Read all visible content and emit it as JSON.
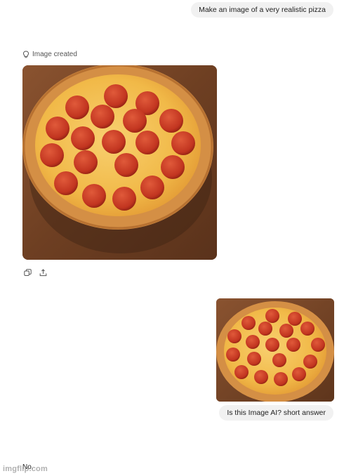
{
  "conversation": {
    "user_prompt_1": "Make an image of a very realistic pizza",
    "status_label": "Image created",
    "user_prompt_2": "Is this Image AI? short answer",
    "assistant_answer": "No."
  },
  "image_alt": {
    "generated": "Generated pizza image",
    "uploaded": "Uploaded pizza image"
  },
  "icons": {
    "status": "bulb-icon",
    "copy": "copy-icon",
    "share": "share-icon"
  },
  "watermark": "imgflip.com",
  "colors": {
    "bubble_bg": "#f1f1f1",
    "wood": "#7a4a2c",
    "crust": "#d89a52",
    "cheese": "#f4c25a",
    "pepperoni": "#c63a23"
  }
}
